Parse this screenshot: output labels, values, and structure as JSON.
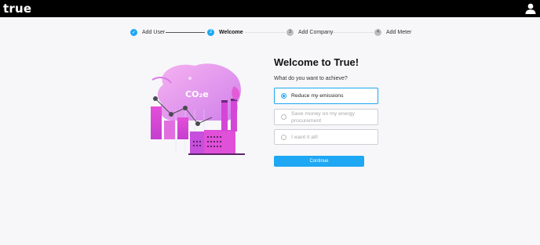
{
  "header": {
    "logo_text": "true",
    "user_icon": "user-icon",
    "background": "#000000"
  },
  "stepper": {
    "steps": [
      {
        "label": "Add User",
        "state": "done",
        "marker": "✓"
      },
      {
        "label": "Welcome",
        "state": "active",
        "marker": "2"
      },
      {
        "label": "Add Company",
        "state": "pending",
        "marker": "3"
      },
      {
        "label": "Add Meter",
        "state": "pending",
        "marker": "4"
      }
    ]
  },
  "illustration": {
    "icon": "co2-factory-illustration",
    "co2_text": "CO₂e"
  },
  "main": {
    "title": "Welcome to True!",
    "question": "What do you want to achieve?",
    "options": [
      {
        "label": "Reduce my emissions",
        "selected": true
      },
      {
        "label": "Save money on my energy procurement",
        "selected": false
      },
      {
        "label": "I want it all!",
        "selected": false
      }
    ],
    "continue_label": "Continue"
  },
  "colors": {
    "accent": "#1ea7f3",
    "illustration_magenta": "#e04ad8",
    "illustration_purple": "#a84fe0"
  }
}
